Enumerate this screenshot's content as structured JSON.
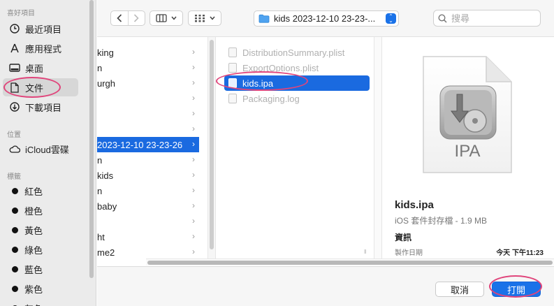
{
  "sidebar": {
    "favorites_header": "喜好項目",
    "favorites": [
      {
        "label": "最近項目",
        "icon": "clock-icon"
      },
      {
        "label": "應用程式",
        "icon": "apps-icon"
      },
      {
        "label": "桌面",
        "icon": "desktop-icon"
      },
      {
        "label": "文件",
        "icon": "document-icon",
        "selected": true
      },
      {
        "label": "下載項目",
        "icon": "download-icon"
      }
    ],
    "locations_header": "位置",
    "locations": [
      {
        "label": "iCloud雲碟",
        "icon": "cloud-icon"
      }
    ],
    "tags_header": "標籤",
    "tags": [
      {
        "label": "紅色"
      },
      {
        "label": "橙色"
      },
      {
        "label": "黃色"
      },
      {
        "label": "綠色"
      },
      {
        "label": "藍色"
      },
      {
        "label": "紫色"
      },
      {
        "label": "灰色"
      }
    ]
  },
  "toolbar": {
    "path": "kids 2023-12-10 23-23-...",
    "search_placeholder": "搜尋"
  },
  "column1": [
    {
      "label": "king"
    },
    {
      "label": "n"
    },
    {
      "label": "urgh"
    },
    {
      "label": ""
    },
    {
      "label": ""
    },
    {
      "label": ""
    },
    {
      "label": "2023-12-10 23-23-26",
      "selected": true
    },
    {
      "label": "n"
    },
    {
      "label": "kids"
    },
    {
      "label": "n"
    },
    {
      "label": "baby"
    },
    {
      "label": ""
    },
    {
      "label": "ht"
    },
    {
      "label": "me2"
    }
  ],
  "column2": [
    {
      "label": "DistributionSummary.plist"
    },
    {
      "label": "ExportOptions.plist"
    },
    {
      "label": "kids.ipa",
      "selected": true
    },
    {
      "label": "Packaging.log"
    }
  ],
  "preview": {
    "icon_label": "IPA",
    "name": "kids.ipa",
    "subtitle": "iOS 套件封存檔 - 1.9 MB",
    "info_header": "資訊",
    "created_label": "製作日期",
    "created_value": "今天 下午11:23"
  },
  "buttons": {
    "cancel": "取消",
    "open": "打開"
  }
}
